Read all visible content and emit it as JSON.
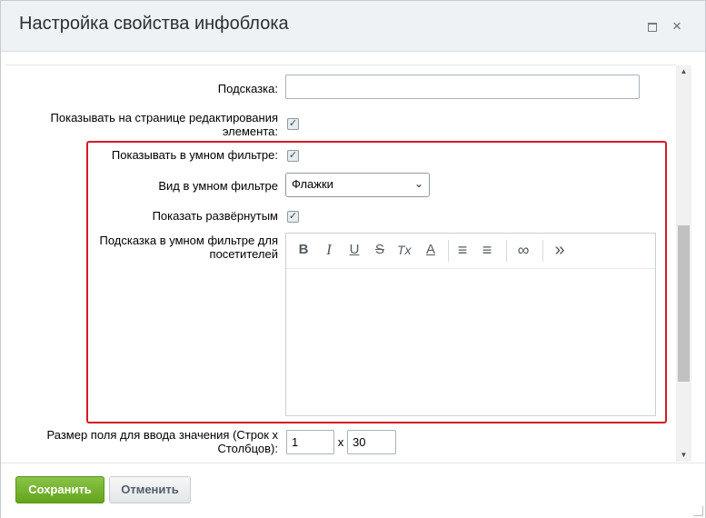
{
  "dialog": {
    "title": "Настройка свойства инфоблока",
    "maximize_icon": "maximize-icon",
    "close_icon": "close-icon",
    "close_glyph": "×"
  },
  "form": {
    "hint_label": "Подсказка:",
    "hint_value": "",
    "show_on_edit_label": "Показывать на странице редактирования элемента:",
    "show_on_edit_checked": true,
    "smart_filter_label": "Показывать в умном фильтре:",
    "smart_filter_checked": true,
    "smart_filter_view_label": "Вид в умном фильтре",
    "smart_filter_view_value": "Флажки",
    "show_expanded_label": "Показать развёрнутым",
    "show_expanded_checked": true,
    "filter_hint_label": "Подсказка в умном фильтре для посетителей",
    "size_label": "Размер поля для ввода значения (Строк х Столбцов):",
    "rows_value": "1",
    "size_separator": "x",
    "cols_value": "30"
  },
  "editor_toolbar": [
    {
      "name": "bold-icon",
      "glyph": "B"
    },
    {
      "name": "italic-icon",
      "glyph": "I"
    },
    {
      "name": "underline-icon",
      "glyph": "U"
    },
    {
      "name": "strikethrough-icon",
      "glyph": "S"
    },
    {
      "name": "clear-format-icon",
      "glyph": "Tx"
    },
    {
      "name": "font-color-icon",
      "glyph": "A"
    },
    {
      "name": "ordered-list-icon",
      "glyph": "≡"
    },
    {
      "name": "unordered-list-icon",
      "glyph": "≡"
    },
    {
      "name": "link-icon",
      "glyph": "∞"
    },
    {
      "name": "more-icon",
      "glyph": "»"
    }
  ],
  "footer": {
    "save_label": "Сохранить",
    "cancel_label": "Отменить"
  },
  "colors": {
    "highlight_border": "#d21b24",
    "save_button": "#7ab42f",
    "titlebar": "#eef2f4"
  }
}
